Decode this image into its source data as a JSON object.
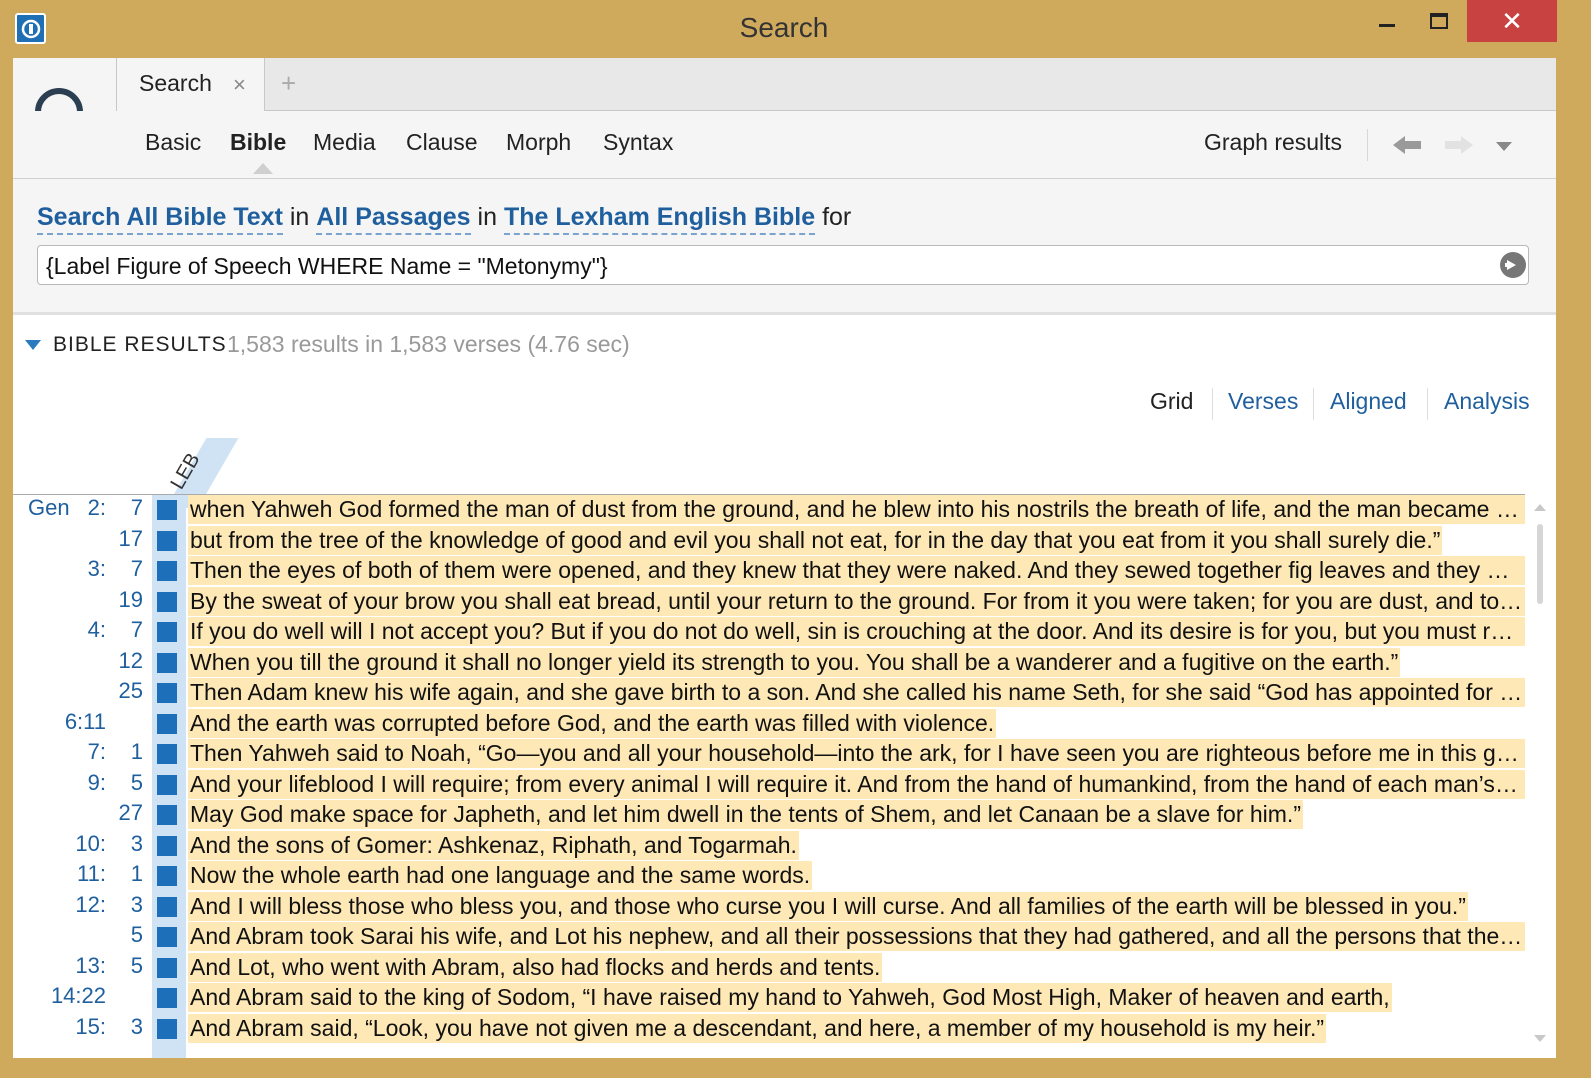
{
  "window": {
    "title": "Search",
    "close_glyph": "✕",
    "colors": {
      "frame": "#cfaa5c",
      "close": "#c84241",
      "accent": "#1f6fb5",
      "link": "#1f5f9e",
      "highlight": "#fde8b6"
    }
  },
  "tabs": {
    "active_tab_label": "Search",
    "close_glyph": "×",
    "add_glyph": "+"
  },
  "ribbon": {
    "tabs": [
      "Basic",
      "Bible",
      "Media",
      "Clause",
      "Morph",
      "Syntax"
    ],
    "active_tab": "Bible",
    "graph_results": "Graph results"
  },
  "query": {
    "search_scope": "Search All Bible Text",
    "in1": "in",
    "passages": "All Passages",
    "in2": "in",
    "resource": "The Lexham English Bible",
    "for": "for",
    "value": "{Label Figure of Speech WHERE Name = \"Metonymy\"}"
  },
  "results": {
    "title": "BIBLE RESULTS",
    "summary": "1,583 results in 1,583 verses (4.76 sec)",
    "views": [
      "Grid",
      "Verses",
      "Aligned",
      "Analysis"
    ],
    "active_view": "Grid",
    "column_label": "LEB",
    "rows": [
      {
        "book": "Gen",
        "ch": "2:",
        "v": "7",
        "text": "when Yahweh God formed the man of dust from the ground, and he blew into his nostrils the breath of life, and the man became a living being."
      },
      {
        "book": "",
        "ch": "",
        "v": "17",
        "text": "but from the tree of the knowledge of good and evil you shall not eat, for in the day that you eat from it you shall surely die.”"
      },
      {
        "book": "",
        "ch": "3:",
        "v": "7",
        "text": "Then the eyes of both of them were opened, and they knew that they were naked. And they sewed together fig leaves and they made loincloths for themselves."
      },
      {
        "book": "",
        "ch": "",
        "v": "19",
        "text": "By the sweat of your brow you shall eat bread, until your return to the ground. For from it you were taken; for you are dust, and to dust you shall return.”"
      },
      {
        "book": "",
        "ch": "4:",
        "v": "7",
        "text": "If you do well will I not accept you? But if you do not do well, sin is crouching at the door. And its desire is for you, but you must rule over it.”"
      },
      {
        "book": "",
        "ch": "",
        "v": "12",
        "text": "When you till the ground it shall no longer yield its strength to you. You shall be a wanderer and a fugitive on the earth.”"
      },
      {
        "book": "",
        "ch": "",
        "v": "25",
        "text": "Then Adam knew his wife again, and she gave birth to a son. And she called his name Seth, for she said “God has appointed for me another offspring.”"
      },
      {
        "book": "",
        "ch": "6:11",
        "v": "",
        "text": "And the earth was corrupted before God, and the earth was filled with violence."
      },
      {
        "book": "",
        "ch": "7:",
        "v": "1",
        "text": "Then Yahweh said to Noah, “Go—you and all your household—into the ark, for I have seen you are righteous before me in this generation."
      },
      {
        "book": "",
        "ch": "9:",
        "v": "5",
        "text": "And your lifeblood I will require; from every animal I will require it. And from the hand of humankind, from the hand of each man’s brother, I will require the life of humankind."
      },
      {
        "book": "",
        "ch": "",
        "v": "27",
        "text": "May God make space for Japheth, and let him dwell in the tents of Shem, and let Canaan be a slave for him.”"
      },
      {
        "book": "",
        "ch": "10:",
        "v": "3",
        "text": "And the sons of Gomer: Ashkenaz, Riphath, and Togarmah."
      },
      {
        "book": "",
        "ch": "11:",
        "v": "1",
        "text": "Now the whole earth had one language and the same words."
      },
      {
        "book": "",
        "ch": "12:",
        "v": "3",
        "text": "And I will bless those who bless you, and those who curse you I will curse. And all families of the earth will be blessed in you.”"
      },
      {
        "book": "",
        "ch": "",
        "v": "5",
        "text": "And Abram took Sarai his wife, and Lot his nephew, and all their possessions that they had gathered, and all the persons that they had acquired in Haran."
      },
      {
        "book": "",
        "ch": "13:",
        "v": "5",
        "text": "And Lot, who went with Abram, also had flocks and herds and tents."
      },
      {
        "book": "",
        "ch": "14:22",
        "v": "",
        "text": "And Abram said to the king of Sodom, “I have raised my hand to Yahweh, God Most High, Maker of heaven and earth,"
      },
      {
        "book": "",
        "ch": "15:",
        "v": "3",
        "text": "And Abram said, “Look, you have not given me a descendant, and here, a member of my household is my heir.”"
      }
    ]
  }
}
